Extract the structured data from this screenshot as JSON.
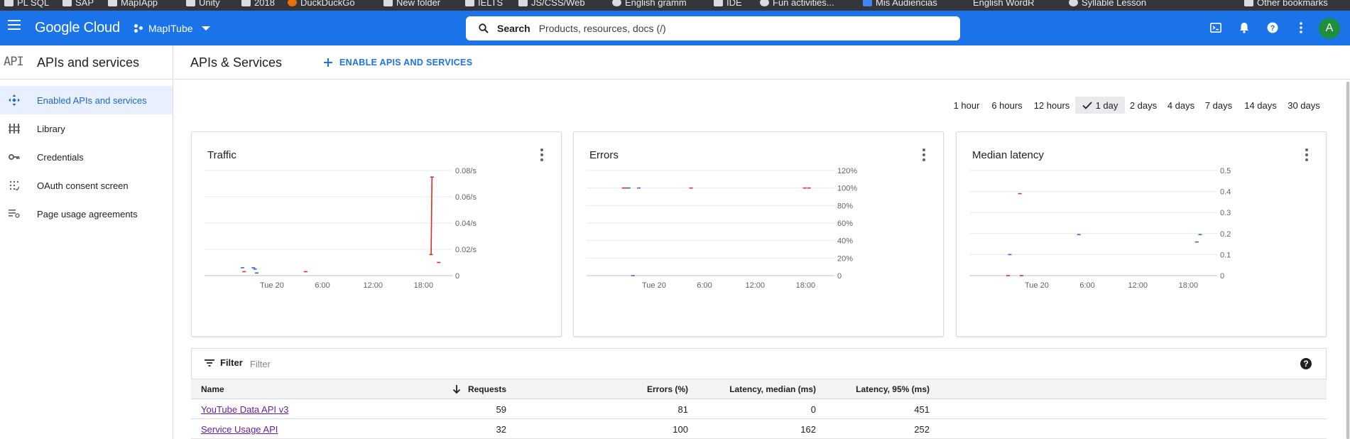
{
  "bookmarks": [
    {
      "label": "PL SQL",
      "icon": "folder-icon"
    },
    {
      "label": "SAP",
      "icon": "folder-icon"
    },
    {
      "label": "MapIApp",
      "icon": "folder-icon"
    },
    {
      "label": "Unity",
      "icon": "folder-icon"
    },
    {
      "label": "2018",
      "icon": "folder-icon"
    },
    {
      "label": "DuckDuckGo",
      "icon": "duckduckgo-icon"
    },
    {
      "label": "New folder",
      "icon": "folder-icon"
    },
    {
      "label": "IELTS",
      "icon": "folder-icon"
    },
    {
      "label": "JS/CSS/Web",
      "icon": "folder-icon"
    },
    {
      "label": "English gramm",
      "icon": "globe-icon"
    },
    {
      "label": "IDE",
      "icon": "folder-icon"
    },
    {
      "label": "Fun activities...",
      "icon": "globe-icon"
    },
    {
      "label": "Mis Audiencias",
      "icon": "chart-icon"
    },
    {
      "label": "English WordR",
      "icon": "blank-icon"
    },
    {
      "label": "Syllable Lesson",
      "icon": "globe-icon"
    },
    {
      "label": "Other bookmarks",
      "icon": "folder-icon"
    }
  ],
  "topbar": {
    "product": "Google Cloud",
    "project": "MapITube",
    "search_label": "Search",
    "search_placeholder": "Products, resources, docs (/)",
    "avatar_letter": "A",
    "accent": "#1a73e8"
  },
  "sidebar": {
    "logo": "API",
    "title": "APIs and services",
    "items": [
      {
        "label": "Enabled APIs and services",
        "icon": "apis-icon",
        "active": true
      },
      {
        "label": "Library",
        "icon": "library-icon",
        "active": false
      },
      {
        "label": "Credentials",
        "icon": "key-icon",
        "active": false
      },
      {
        "label": "OAuth consent screen",
        "icon": "oauth-icon",
        "active": false
      },
      {
        "label": "Page usage agreements",
        "icon": "agreements-icon",
        "active": false
      }
    ]
  },
  "main": {
    "title": "APIs & Services",
    "enable_button": "ENABLE APIS AND SERVICES",
    "time_ranges": [
      "1 hour",
      "6 hours",
      "12 hours",
      "1 day",
      "2 days",
      "4 days",
      "7 days",
      "14 days",
      "30 days"
    ],
    "selected_range": "1 day"
  },
  "chart_data": [
    {
      "type": "line",
      "title": "Traffic",
      "x_ticks": [
        "Tue 20",
        "6:00",
        "12:00",
        "18:00"
      ],
      "y_ticks": [
        "0",
        "0.02/s",
        "0.04/s",
        "0.06/s",
        "0.08/s"
      ],
      "ylim": [
        0,
        0.08
      ],
      "y_unit": "/s",
      "grid": true,
      "series": [
        {
          "color": "#d93025",
          "points": [
            [
              -3.3,
              0.003
            ],
            [
              4.0,
              0.003
            ],
            [
              18.9,
              0.016
            ],
            [
              19.0,
              0.075
            ],
            [
              19.8,
              0.01
            ]
          ]
        },
        {
          "color": "#3367d6",
          "points": [
            [
              -3.5,
              0.006
            ],
            [
              -2.2,
              0.006
            ],
            [
              -2.0,
              0.005
            ],
            [
              -1.8,
              0.002
            ]
          ]
        }
      ]
    },
    {
      "type": "line",
      "title": "Errors",
      "x_ticks": [
        "Tue 20",
        "6:00",
        "12:00",
        "18:00"
      ],
      "y_ticks": [
        "0",
        "20%",
        "40%",
        "60%",
        "80%",
        "100%",
        "120%"
      ],
      "ylim": [
        0,
        120
      ],
      "y_unit": "%",
      "grid": true,
      "series": [
        {
          "color": "#d93025",
          "points": [
            [
              -3.6,
              100
            ],
            [
              -3.2,
              100
            ],
            [
              4.4,
              100
            ],
            [
              17.9,
              100
            ],
            [
              18.4,
              100
            ]
          ]
        },
        {
          "color": "#3367d6",
          "points": [
            [
              -3.0,
              100
            ],
            [
              -1.8,
              100
            ],
            [
              -2.5,
              0
            ]
          ]
        }
      ]
    },
    {
      "type": "line",
      "title": "Median latency",
      "x_ticks": [
        "Tue 20",
        "6:00",
        "12:00",
        "18:00"
      ],
      "y_ticks": [
        "0",
        "0.1",
        "0.2",
        "0.3",
        "0.4",
        "0.5"
      ],
      "ylim": [
        0,
        0.5
      ],
      "grid": true,
      "series": [
        {
          "color": "#d93025",
          "points": [
            [
              -2.0,
              0.39
            ],
            [
              -3.4,
              0.0
            ],
            [
              -1.8,
              0.0
            ]
          ]
        },
        {
          "color": "#3367d6",
          "points": [
            [
              -3.2,
              0.1
            ],
            [
              5.0,
              0.195
            ],
            [
              19.0,
              0.16
            ],
            [
              19.4,
              0.195
            ]
          ]
        }
      ]
    }
  ],
  "filter": {
    "label": "Filter",
    "placeholder": "Filter"
  },
  "table": {
    "columns": [
      "Name",
      "Requests",
      "Errors (%)",
      "Latency, median (ms)",
      "Latency, 95% (ms)"
    ],
    "rows": [
      {
        "name": "YouTube Data API v3",
        "requests": "59",
        "errors": "81",
        "lat_median": "0",
        "lat_95": "451"
      },
      {
        "name": "Service Usage API",
        "requests": "32",
        "errors": "100",
        "lat_median": "162",
        "lat_95": "252"
      }
    ]
  }
}
